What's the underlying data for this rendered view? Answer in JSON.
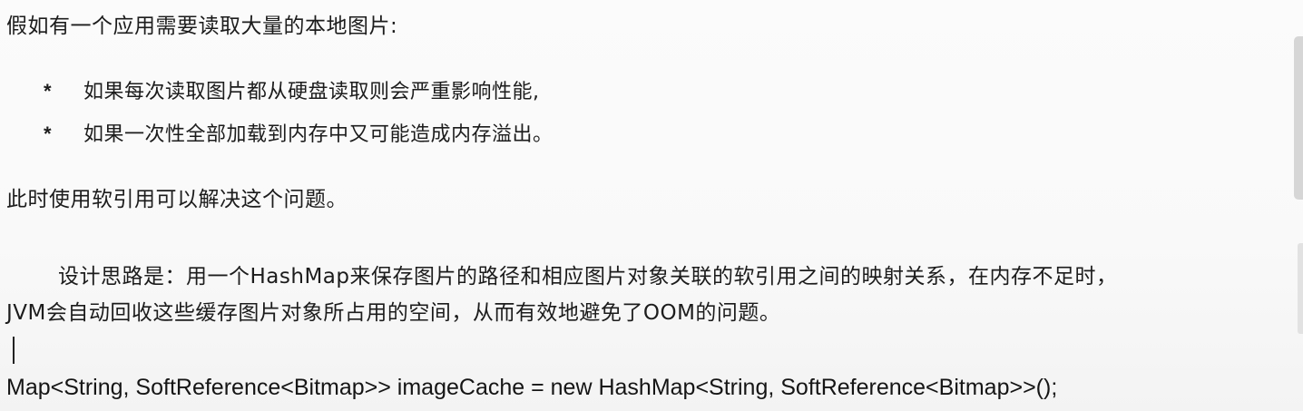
{
  "document": {
    "intro": "假如有一个应用需要读取大量的本地图片:",
    "bullets": [
      {
        "marker": "*",
        "text": "如果每次读取图片都从硬盘读取则会严重影响性能,"
      },
      {
        "marker": "*",
        "text": "如果一次性全部加载到内存中又可能造成内存溢出。"
      }
    ],
    "solution": "此时使用软引用可以解决这个问题。",
    "design_line1": "设计思路是：用一个HashMap来保存图片的路径和相应图片对象关联的软引用之间的映射关系，在内存不足时，",
    "design_line2": "JVM会自动回收这些缓存图片对象所占用的空间，从而有效地避免了OOM的问题。",
    "code": "Map<String, SoftReference<Bitmap>> imageCache = new HashMap<String, SoftReference<Bitmap>>();"
  }
}
